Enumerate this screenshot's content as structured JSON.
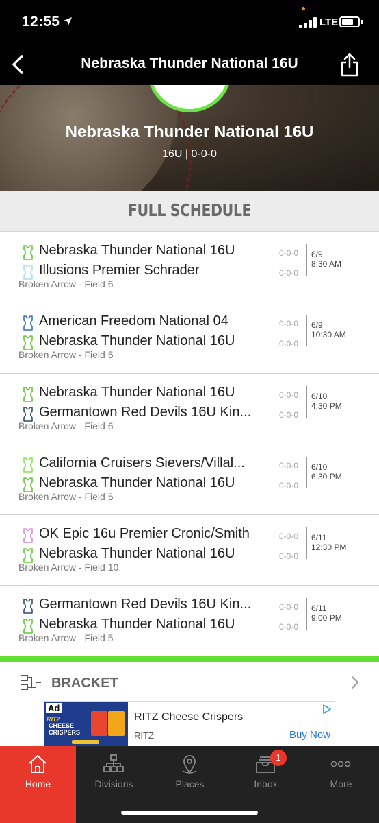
{
  "status_bar": {
    "time": "12:55",
    "network": "LTE",
    "location_icon": "location-arrow-icon"
  },
  "nav": {
    "title": "Nebraska Thunder National 16U",
    "back_icon": "chevron-left-icon",
    "share_icon": "share-icon"
  },
  "hero": {
    "team_name": "Nebraska Thunder National 16U",
    "subtitle": "16U | 0-0-0",
    "logo_color": "#6de04a"
  },
  "schedule": {
    "heading": "FULL SCHEDULE",
    "games": [
      {
        "team1": {
          "name": "Nebraska Thunder National 16U",
          "record": "0-0-0",
          "jersey_color": "#63c936"
        },
        "team2": {
          "name": "Illusions Premier Schrader",
          "record": "0-0-0",
          "jersey_color": "#a6dff0"
        },
        "location": "Broken Arrow - Field 6",
        "date": "6/9",
        "time": "8:30 AM"
      },
      {
        "team1": {
          "name": "American Freedom National 04",
          "record": "0-0-0",
          "jersey_color": "#3b6fc9"
        },
        "team2": {
          "name": "Nebraska Thunder National 16U",
          "record": "0-0-0",
          "jersey_color": "#63c936"
        },
        "location": "Broken Arrow - Field 5",
        "date": "6/9",
        "time": "10:30 AM"
      },
      {
        "team1": {
          "name": "Nebraska Thunder National 16U",
          "record": "0-0-0",
          "jersey_color": "#63c936"
        },
        "team2": {
          "name": "Germantown Red Devils 16U Kin...",
          "record": "0-0-0",
          "jersey_color": "#2f4f6f"
        },
        "location": "Broken Arrow - Field 6",
        "date": "6/10",
        "time": "4:30 PM"
      },
      {
        "team1": {
          "name": "California Cruisers Sievers/Villal...",
          "record": "0-0-0",
          "jersey_color": "#8fe05c"
        },
        "team2": {
          "name": "Nebraska Thunder National 16U",
          "record": "0-0-0",
          "jersey_color": "#63c936"
        },
        "location": "Broken Arrow - Field 5",
        "date": "6/10",
        "time": "6:30 PM"
      },
      {
        "team1": {
          "name": "OK Epic 16u Premier Cronic/Smith",
          "record": "0-0-0",
          "jersey_color": "#d98ad9"
        },
        "team2": {
          "name": "Nebraska Thunder National 16U",
          "record": "0-0-0",
          "jersey_color": "#63c936"
        },
        "location": "Broken Arrow - Field 10",
        "date": "6/11",
        "time": "12:30 PM"
      },
      {
        "team1": {
          "name": "Germantown Red Devils 16U Kin...",
          "record": "0-0-0",
          "jersey_color": "#2f4f6f"
        },
        "team2": {
          "name": "Nebraska Thunder National 16U",
          "record": "0-0-0",
          "jersey_color": "#63c936"
        },
        "location": "Broken Arrow - Field 5",
        "date": "6/11",
        "time": "9:00 PM"
      }
    ]
  },
  "bracket": {
    "label": "BRACKET",
    "icon": "bracket-icon"
  },
  "ad": {
    "tag": "Ad",
    "image_brand": "RITZ",
    "image_product": "CHEESE CRISPERS",
    "title": "RITZ Cheese Crispers",
    "sponsor": "RITZ",
    "cta": "Buy Now"
  },
  "tabs": [
    {
      "label": "Home",
      "icon": "home-icon",
      "active": true
    },
    {
      "label": "Divisions",
      "icon": "divisions-icon",
      "active": false
    },
    {
      "label": "Places",
      "icon": "map-pin-icon",
      "active": false
    },
    {
      "label": "Inbox",
      "icon": "inbox-icon",
      "active": false,
      "badge": "1"
    },
    {
      "label": "More",
      "icon": "more-icon",
      "active": false
    }
  ],
  "colors": {
    "accent_green": "#63e036",
    "tab_active": "#e8372b",
    "tab_bar_bg": "#222222"
  }
}
